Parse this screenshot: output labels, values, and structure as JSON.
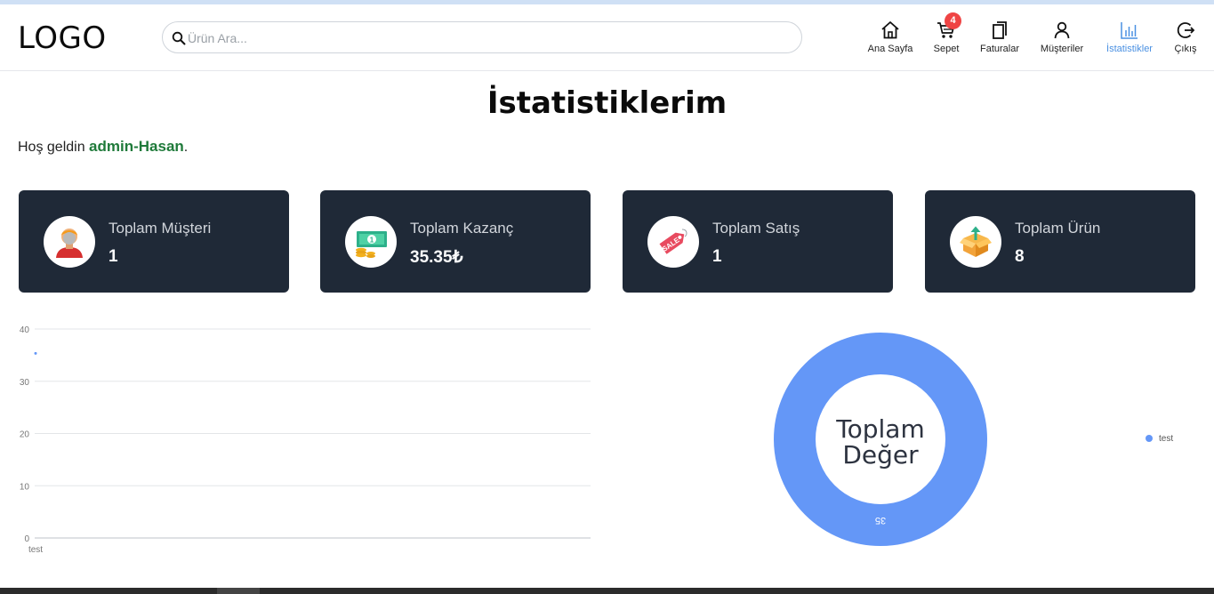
{
  "header": {
    "logo": "LOGO",
    "search_placeholder": "Ürün Ara...",
    "nav": [
      {
        "label": "Ana Sayfa",
        "icon": "home-icon"
      },
      {
        "label": "Sepet",
        "icon": "cart-icon",
        "badge": "4"
      },
      {
        "label": "Faturalar",
        "icon": "invoices-icon"
      },
      {
        "label": "Müşteriler",
        "icon": "user-icon"
      },
      {
        "label": "İstatistikler",
        "icon": "bar-chart-icon",
        "active": true
      },
      {
        "label": "Çıkış",
        "icon": "logout-icon"
      }
    ]
  },
  "page": {
    "title": "İstatistiklerim",
    "welcome_prefix": "Hoş geldin ",
    "welcome_user": "admin-Hasan",
    "welcome_suffix": "."
  },
  "cards": [
    {
      "title": "Toplam Müşteri",
      "value": "1",
      "icon": "customer-avatar-icon"
    },
    {
      "title": "Toplam Kazanç",
      "value": "35.35₺",
      "icon": "money-icon"
    },
    {
      "title": "Toplam Satış",
      "value": "1",
      "icon": "sale-tag-icon"
    },
    {
      "title": "Toplam Ürün",
      "value": "8",
      "icon": "product-box-icon"
    }
  ],
  "colors": {
    "card_bg": "#1f2937",
    "accent_blue": "#6497f7",
    "active_nav": "#4a90e2",
    "welcome_user": "#1f7a3a",
    "badge": "#ef4444"
  },
  "chart_data": [
    {
      "type": "line",
      "categories": [
        "test"
      ],
      "series": [
        {
          "values": [
            35.35
          ]
        }
      ],
      "ylim": [
        0,
        40
      ],
      "yticks": [
        0,
        10,
        20,
        30,
        40
      ],
      "grid": true
    },
    {
      "type": "pie",
      "style": "doughnut",
      "labels": [
        "test"
      ],
      "values": [
        35.35
      ],
      "center_text": [
        "Toplam",
        "Değer"
      ],
      "slice_label": "35",
      "legend": "right"
    }
  ]
}
